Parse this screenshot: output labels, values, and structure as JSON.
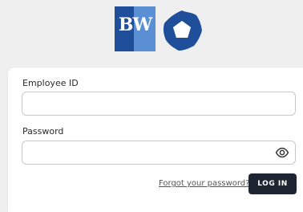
{
  "brand": {
    "logo_text": "BW",
    "colors": {
      "dark_blue": "#1f4e9a",
      "light_blue": "#5b8fd3",
      "mark": "#1f4e9a"
    }
  },
  "form": {
    "employee_id": {
      "label": "Employee ID",
      "value": "",
      "placeholder": ""
    },
    "password": {
      "label": "Password",
      "value": "",
      "placeholder": "",
      "toggle_icon": "eye-icon"
    },
    "forgot_link": "Forgot your password?",
    "login_button": "LOG IN"
  }
}
